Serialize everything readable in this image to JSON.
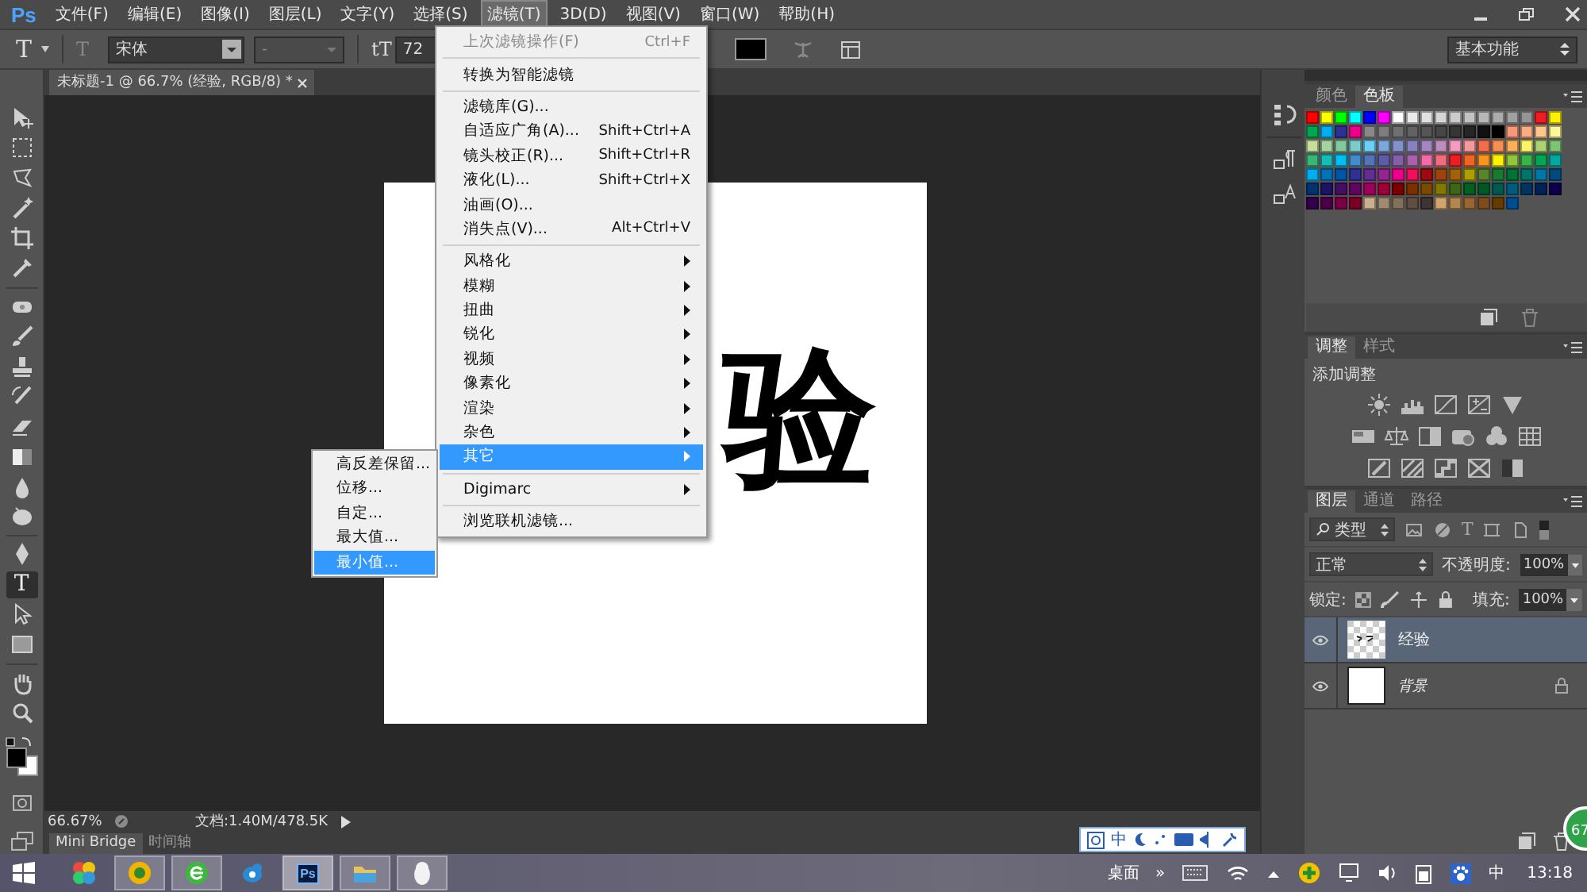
{
  "app_logo": "Ps",
  "menu_bar": [
    {
      "label": "文件(F)",
      "selected": false
    },
    {
      "label": "编辑(E)",
      "selected": false
    },
    {
      "label": "图像(I)",
      "selected": false
    },
    {
      "label": "图层(L)",
      "selected": false
    },
    {
      "label": "文字(Y)",
      "selected": false
    },
    {
      "label": "选择(S)",
      "selected": false
    },
    {
      "label": "滤镜(T)",
      "selected": true
    },
    {
      "label": "3D(D)",
      "selected": false
    },
    {
      "label": "视图(V)",
      "selected": false
    },
    {
      "label": "窗口(W)",
      "selected": false
    },
    {
      "label": "帮助(H)",
      "selected": false
    }
  ],
  "options_bar": {
    "tool_glyph": "T",
    "orient_glyph": "T",
    "font_family": "宋体",
    "font_style": "-",
    "size_glyph": "tT",
    "font_size": "72",
    "workspace": "基本功能"
  },
  "document_tab": {
    "title": "未标题-1 @ 66.7% (经验, RGB/8) *"
  },
  "tools": [
    {
      "kind": "move",
      "selected": false
    },
    {
      "kind": "marquee",
      "selected": false
    },
    {
      "kind": "lasso",
      "selected": false
    },
    {
      "kind": "wand",
      "selected": false
    },
    {
      "kind": "crop",
      "selected": false
    },
    {
      "kind": "eyedropper",
      "selected": false
    },
    {
      "kind": "divider"
    },
    {
      "kind": "heal",
      "selected": false
    },
    {
      "kind": "brush",
      "selected": false
    },
    {
      "kind": "stamp",
      "selected": false
    },
    {
      "kind": "history",
      "selected": false
    },
    {
      "kind": "eraser",
      "selected": false
    },
    {
      "kind": "gradient",
      "selected": false
    },
    {
      "kind": "blur",
      "selected": false
    },
    {
      "kind": "dodge",
      "selected": false
    },
    {
      "kind": "divider"
    },
    {
      "kind": "pen",
      "selected": false
    },
    {
      "kind": "type",
      "glyph": "T",
      "selected": true
    },
    {
      "kind": "path",
      "selected": false
    },
    {
      "kind": "shape",
      "selected": false
    },
    {
      "kind": "divider"
    },
    {
      "kind": "hand",
      "selected": false
    },
    {
      "kind": "zoom",
      "selected": false
    }
  ],
  "canvas": {
    "text": "验"
  },
  "filter_menu": [
    {
      "kind": "item",
      "label": "上次滤镜操作(F)",
      "shortcut": "Ctrl+F",
      "disabled": true,
      "selected": false
    },
    {
      "kind": "separator"
    },
    {
      "kind": "item",
      "label": "转换为智能滤镜",
      "disabled": false,
      "selected": false
    },
    {
      "kind": "separator"
    },
    {
      "kind": "item",
      "label": "滤镜库(G)...",
      "disabled": false,
      "selected": false
    },
    {
      "kind": "item",
      "label": "自适应广角(A)...",
      "shortcut": "Shift+Ctrl+A",
      "disabled": false,
      "selected": false
    },
    {
      "kind": "item",
      "label": "镜头校正(R)...",
      "shortcut": "Shift+Ctrl+R",
      "disabled": false,
      "selected": false
    },
    {
      "kind": "item",
      "label": "液化(L)...",
      "shortcut": "Shift+Ctrl+X",
      "disabled": false,
      "selected": false
    },
    {
      "kind": "item",
      "label": "油画(O)...",
      "disabled": false,
      "selected": false
    },
    {
      "kind": "item",
      "label": "消失点(V)...",
      "shortcut": "Alt+Ctrl+V",
      "disabled": false,
      "selected": false
    },
    {
      "kind": "separator"
    },
    {
      "kind": "submenu",
      "label": "风格化",
      "disabled": false,
      "selected": false
    },
    {
      "kind": "submenu",
      "label": "模糊",
      "disabled": false,
      "selected": false
    },
    {
      "kind": "submenu",
      "label": "扭曲",
      "disabled": false,
      "selected": false
    },
    {
      "kind": "submenu",
      "label": "锐化",
      "disabled": false,
      "selected": false
    },
    {
      "kind": "submenu",
      "label": "视频",
      "disabled": false,
      "selected": false
    },
    {
      "kind": "submenu",
      "label": "像素化",
      "disabled": false,
      "selected": false
    },
    {
      "kind": "submenu",
      "label": "渲染",
      "disabled": false,
      "selected": false
    },
    {
      "kind": "submenu",
      "label": "杂色",
      "disabled": false,
      "selected": false
    },
    {
      "kind": "submenu",
      "label": "其它",
      "disabled": false,
      "selected": true
    },
    {
      "kind": "separator"
    },
    {
      "kind": "submenu",
      "label": "Digimarc",
      "disabled": false,
      "selected": false
    },
    {
      "kind": "separator"
    },
    {
      "kind": "item",
      "label": "浏览联机滤镜...",
      "disabled": false,
      "selected": false
    }
  ],
  "other_submenu": [
    {
      "label": "高反差保留...",
      "selected": false
    },
    {
      "label": "位移...",
      "selected": false
    },
    {
      "label": "自定...",
      "selected": false
    },
    {
      "label": "最大值...",
      "selected": false
    },
    {
      "label": "最小值...",
      "selected": true
    }
  ],
  "swatches_panel": {
    "tabs": [
      {
        "label": "颜色",
        "selected": false
      },
      {
        "label": "色板",
        "selected": true
      }
    ],
    "rows": [
      {
        "swatches": [
          {
            "color": "#ff0000"
          },
          {
            "color": "#ffff00"
          },
          {
            "color": "#00ff00"
          },
          {
            "color": "#00ffff"
          },
          {
            "color": "#0000ff"
          },
          {
            "color": "#ff00ff"
          },
          {
            "color": "#ffffff"
          },
          {
            "color": "#ebebeb"
          },
          {
            "color": "#e1e1e1"
          },
          {
            "color": "#d7d7d7"
          },
          {
            "color": "#cccccc"
          },
          {
            "color": "#c2c2c2"
          },
          {
            "color": "#b7b7b7"
          },
          {
            "color": "#acacac"
          },
          {
            "color": "#a0a0a0"
          },
          {
            "color": "#959595"
          },
          {
            "color": "#ee1d24"
          },
          {
            "color": "#fff100"
          }
        ]
      },
      {
        "swatches": [
          {
            "color": "#00a650"
          },
          {
            "color": "#00aeef"
          },
          {
            "color": "#2f3192"
          },
          {
            "color": "#ed008c"
          },
          {
            "color": "#898989"
          },
          {
            "color": "#7d7d7d"
          },
          {
            "color": "#707070"
          },
          {
            "color": "#626262"
          },
          {
            "color": "#555555"
          },
          {
            "color": "#464646"
          },
          {
            "color": "#363636"
          },
          {
            "color": "#262626"
          },
          {
            "color": "#111111"
          },
          {
            "color": "#000000"
          },
          {
            "color": "#f7977a"
          },
          {
            "color": "#fbad82"
          },
          {
            "color": "#fdc68c"
          },
          {
            "color": "#fff799"
          }
        ]
      },
      {
        "swatches": [
          {
            "color": "#c6df9c"
          },
          {
            "color": "#a4d49d"
          },
          {
            "color": "#81ca9d"
          },
          {
            "color": "#7bcdc9"
          },
          {
            "color": "#6ccff7"
          },
          {
            "color": "#7ca6d8"
          },
          {
            "color": "#8293ca"
          },
          {
            "color": "#8881be"
          },
          {
            "color": "#a286bd"
          },
          {
            "color": "#bc8cbf"
          },
          {
            "color": "#f49bc1"
          },
          {
            "color": "#f5999d"
          },
          {
            "color": "#f16c4d"
          },
          {
            "color": "#f68e54"
          },
          {
            "color": "#fbaf5a"
          },
          {
            "color": "#fff467"
          },
          {
            "color": "#acd372"
          },
          {
            "color": "#7dc473"
          }
        ]
      },
      {
        "swatches": [
          {
            "color": "#39b778"
          },
          {
            "color": "#17bcb4"
          },
          {
            "color": "#00bff3"
          },
          {
            "color": "#438ccb"
          },
          {
            "color": "#5573b7"
          },
          {
            "color": "#5e5ca7"
          },
          {
            "color": "#855fa8"
          },
          {
            "color": "#a763a9"
          },
          {
            "color": "#ef6ea8"
          },
          {
            "color": "#f16d7e"
          },
          {
            "color": "#ee1d24"
          },
          {
            "color": "#f16522"
          },
          {
            "color": "#f7941d"
          },
          {
            "color": "#fff100"
          },
          {
            "color": "#8fc63d"
          },
          {
            "color": "#37b44a"
          },
          {
            "color": "#00a650"
          },
          {
            "color": "#00a99e"
          }
        ]
      },
      {
        "swatches": [
          {
            "color": "#00aeef"
          },
          {
            "color": "#0072bc"
          },
          {
            "color": "#0054a5"
          },
          {
            "color": "#2f3192"
          },
          {
            "color": "#652c91"
          },
          {
            "color": "#91278f"
          },
          {
            "color": "#ed008c"
          },
          {
            "color": "#ee105a"
          },
          {
            "color": "#9d0a0f"
          },
          {
            "color": "#a1410d"
          },
          {
            "color": "#a36209"
          },
          {
            "color": "#aba000"
          },
          {
            "color": "#588528"
          },
          {
            "color": "#197b30"
          },
          {
            "color": "#007236"
          },
          {
            "color": "#00736a"
          },
          {
            "color": "#0076a4"
          },
          {
            "color": "#004a80"
          }
        ]
      },
      {
        "swatches": [
          {
            "color": "#003370"
          },
          {
            "color": "#1d1363"
          },
          {
            "color": "#450e61"
          },
          {
            "color": "#62055f"
          },
          {
            "color": "#9e005c"
          },
          {
            "color": "#9d0039"
          },
          {
            "color": "#790000"
          },
          {
            "color": "#7b3000"
          },
          {
            "color": "#7c4900"
          },
          {
            "color": "#827a00"
          },
          {
            "color": "#3e6617"
          },
          {
            "color": "#045f20"
          },
          {
            "color": "#005824"
          },
          {
            "color": "#005951"
          },
          {
            "color": "#005b7e"
          },
          {
            "color": "#003562"
          },
          {
            "color": "#002056"
          },
          {
            "color": "#0c004b"
          }
        ]
      },
      {
        "swatches": [
          {
            "color": "#30004a"
          },
          {
            "color": "#4b0048"
          },
          {
            "color": "#7a0045"
          },
          {
            "color": "#7a0026"
          },
          {
            "color": "#c8b18b"
          },
          {
            "color": "#a08b71"
          },
          {
            "color": "#827059"
          },
          {
            "color": "#5f4f41"
          },
          {
            "color": "#403430"
          },
          {
            "color": "#d2a56c"
          },
          {
            "color": "#b3864d"
          },
          {
            "color": "#996633"
          },
          {
            "color": "#7e4d1e"
          },
          {
            "color": "#633c00"
          },
          {
            "color": "#004e92"
          }
        ]
      }
    ]
  },
  "adjustments_panel": {
    "tabs": [
      {
        "label": "调整",
        "selected": true
      },
      {
        "label": "样式",
        "selected": false
      }
    ],
    "title": "添加调整"
  },
  "layers_panel": {
    "tabs": [
      {
        "label": "图层",
        "selected": true
      },
      {
        "label": "通道",
        "selected": false
      },
      {
        "label": "路径",
        "selected": false
      }
    ],
    "filter": "类型",
    "filter_type_glyph": "T",
    "blend_mode": "正常",
    "opacity_label": "不透明度:",
    "opacity": "100%",
    "lock_label": "锁定:",
    "fill_label": "填充:",
    "fill": "100%",
    "layers": [
      {
        "kind": "text",
        "name": "经验",
        "visible": true,
        "locked": false,
        "selected": true
      },
      {
        "kind": "background",
        "name": "背景",
        "visible": true,
        "locked": true,
        "selected": false
      }
    ]
  },
  "status_bar": {
    "zoom": "66.67%",
    "document": "文档:1.40M/478.5K"
  },
  "bottom_tabs": [
    {
      "label": "Mini Bridge",
      "selected": true
    },
    {
      "label": "时间轴",
      "selected": false
    }
  ],
  "ime_bar": {
    "language": "中"
  },
  "floating_ball": {
    "value": "67"
  },
  "taskbar": {
    "apps": [
      {
        "kind": "balls",
        "open": false,
        "selected": false
      },
      {
        "kind": "orb",
        "open": true,
        "selected": false
      },
      {
        "kind": "browser",
        "open": true,
        "selected": false
      },
      {
        "kind": "bird",
        "open": false,
        "selected": false
      },
      {
        "kind": "ps",
        "label": "Ps",
        "open": true,
        "selected": true
      },
      {
        "kind": "folder",
        "open": true,
        "selected": false
      },
      {
        "kind": "penguin",
        "open": true,
        "selected": false
      }
    ],
    "desktop_label": "桌面",
    "overflow": "»",
    "input_language": "中",
    "time": "13:18"
  }
}
